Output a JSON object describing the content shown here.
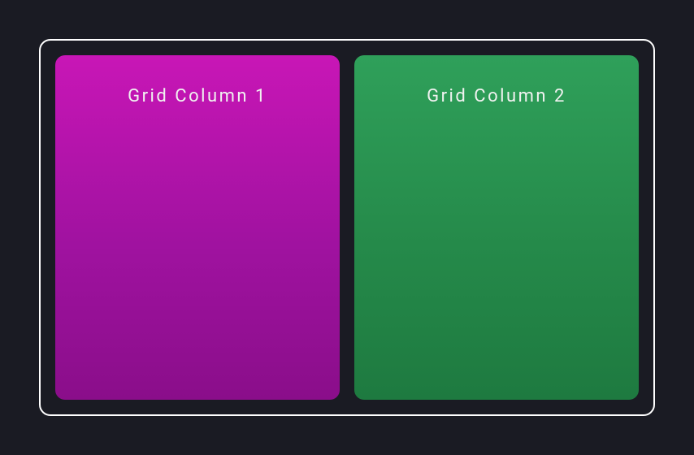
{
  "grid": {
    "columns": [
      {
        "label": "Grid Column 1",
        "color_start": "#c816b6",
        "color_end": "#8a0e8a"
      },
      {
        "label": "Grid Column 2",
        "color_start": "#2fa05a",
        "color_end": "#1e7a40"
      }
    ]
  }
}
